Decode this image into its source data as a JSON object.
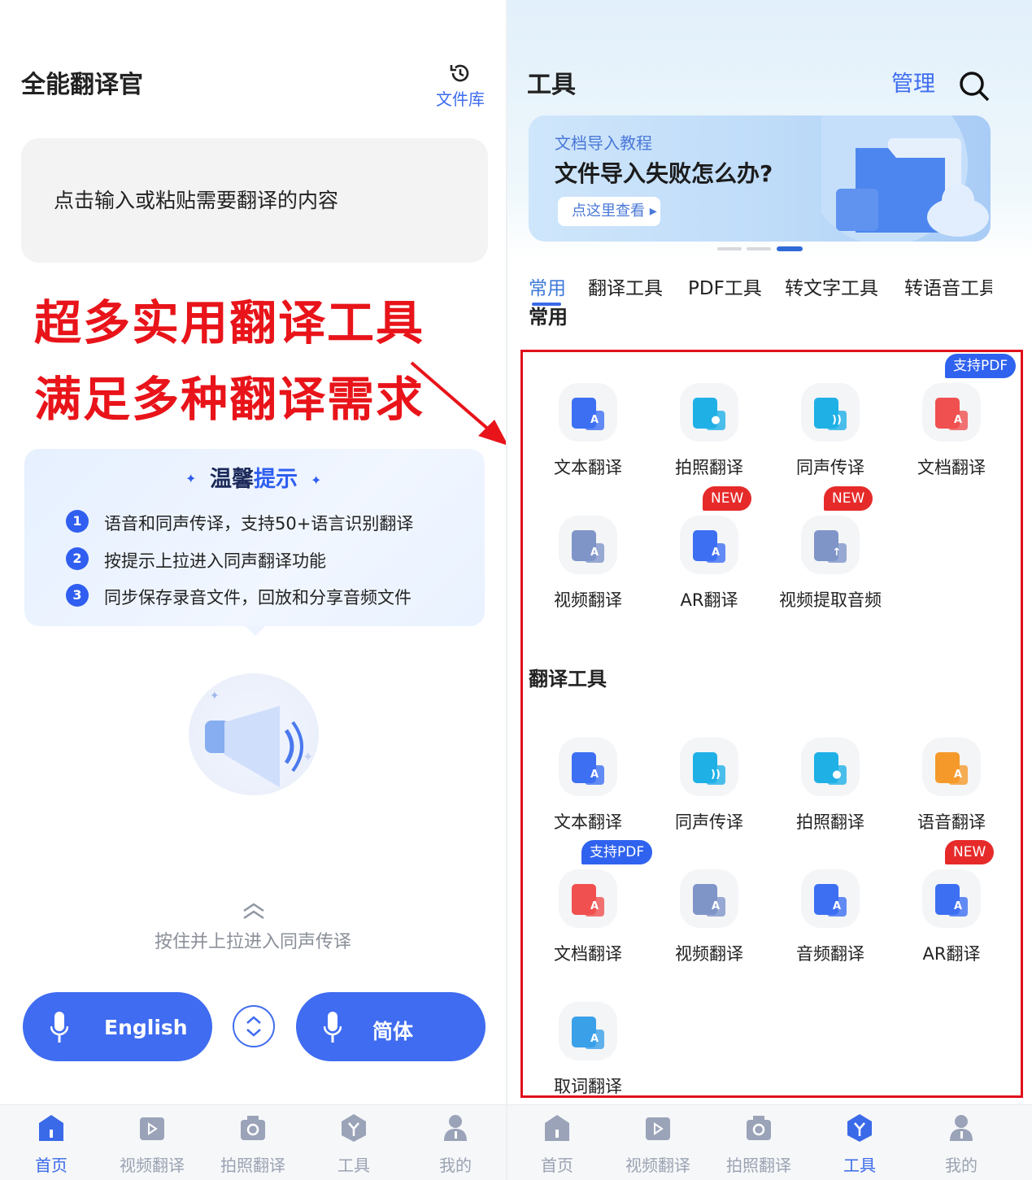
{
  "left": {
    "title": "全能翻译官",
    "library_label": "文件库",
    "input_placeholder": "点击输入或粘贴需要翻译的内容",
    "promo_line1": "超多实用翻译工具",
    "promo_line2": "满足多种翻译需求",
    "tips": {
      "title_a": "温馨",
      "title_b": "提示",
      "items": [
        {
          "num": "1",
          "text": "语音和同声传译，支持50+语言识别翻译"
        },
        {
          "num": "2",
          "text": "按提示上拉进入同声翻译功能"
        },
        {
          "num": "3",
          "text": "同步保存录音文件，回放和分享音频文件"
        }
      ]
    },
    "pull_hint": "按住并上拉进入同声传译",
    "source_lang": "English",
    "target_lang": "简体"
  },
  "right": {
    "title": "工具",
    "manage_label": "管理",
    "banner": {
      "subtitle": "文档导入教程",
      "title": "文件导入失败怎么办?",
      "button": "点这里查看"
    },
    "carousel": {
      "count": 3,
      "active": 3
    },
    "tabs": [
      "常用",
      "翻译工具",
      "PDF工具",
      "转文字工具",
      "转语音工具"
    ],
    "active_tab": "常用",
    "sections": [
      {
        "title": "常用",
        "tools": [
          {
            "label": "文本翻译",
            "color": "#3d6ff2",
            "glyph": "A"
          },
          {
            "label": "拍照翻译",
            "color": "#1fb0e6",
            "glyph": "●"
          },
          {
            "label": "同声传译",
            "color": "#1fb0e6",
            "glyph": "))"
          },
          {
            "label": "文档翻译",
            "color": "#f0504f",
            "glyph": "A",
            "badge": "支持PDF",
            "badge_color": "#2f62ee"
          },
          {
            "label": "视频翻译",
            "color": "#7f95c8",
            "glyph": "A"
          },
          {
            "label": "AR翻译",
            "color": "#3d6ff2",
            "glyph": "A",
            "badge": "NEW",
            "badge_color": "#e62a2a"
          },
          {
            "label": "视频提取音频",
            "color": "#7f95c8",
            "glyph": "↑",
            "badge": "NEW",
            "badge_color": "#e62a2a"
          }
        ]
      },
      {
        "title": "翻译工具",
        "tools": [
          {
            "label": "文本翻译",
            "color": "#3d6ff2",
            "glyph": "A"
          },
          {
            "label": "同声传译",
            "color": "#1fb0e6",
            "glyph": "))"
          },
          {
            "label": "拍照翻译",
            "color": "#1fb0e6",
            "glyph": "●"
          },
          {
            "label": "语音翻译",
            "color": "#f59a2a",
            "glyph": "A"
          },
          {
            "label": "文档翻译",
            "color": "#f0504f",
            "glyph": "A",
            "badge": "支持PDF",
            "badge_color": "#2f62ee"
          },
          {
            "label": "视频翻译",
            "color": "#7f95c8",
            "glyph": "A"
          },
          {
            "label": "音频翻译",
            "color": "#3d6ff2",
            "glyph": "A"
          },
          {
            "label": "AR翻译",
            "color": "#3d6ff2",
            "glyph": "A",
            "badge": "NEW",
            "badge_color": "#e62a2a"
          },
          {
            "label": "取词翻译",
            "color": "#3aa0e8",
            "glyph": "A"
          }
        ]
      }
    ]
  },
  "nav": {
    "items": [
      "首页",
      "视频翻译",
      "拍照翻译",
      "工具",
      "我的"
    ],
    "left_active": "首页",
    "right_active": "工具"
  },
  "colors": {
    "accent": "#3f6cf0",
    "promo_red": "#e8141a",
    "highlight_frame": "#e0101a"
  }
}
